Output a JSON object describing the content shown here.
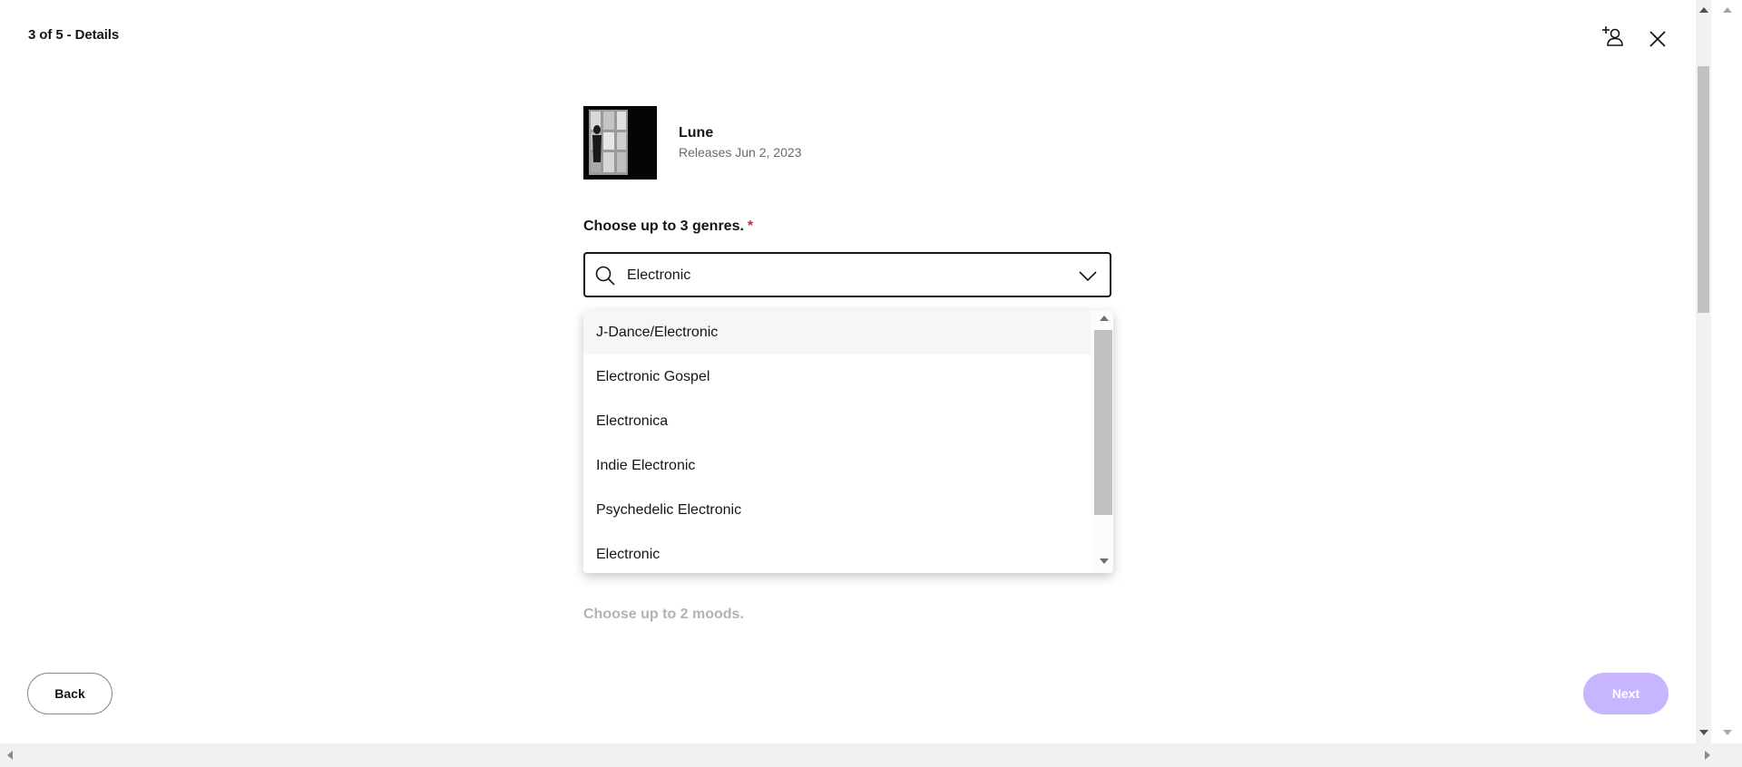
{
  "header": {
    "step_title": "3 of 5 - Details",
    "add_user_icon": "add-user-icon",
    "close_icon": "close-icon"
  },
  "release": {
    "title": "Lune",
    "date": "Releases Jun 2, 2023",
    "cover_icon": "album-cover"
  },
  "genres": {
    "label": "Choose up to 3 genres.",
    "required_mark": "*",
    "search_value": "Electronic",
    "options": [
      "J-Dance/Electronic",
      "Electronic Gospel",
      "Electronica",
      "Indie Electronic",
      "Psychedelic Electronic",
      "Electronic"
    ],
    "highlighted_index": 0
  },
  "moods": {
    "label": "Choose up to 2 moods."
  },
  "footer": {
    "back_label": "Back",
    "next_label": "Next",
    "next_color": "#c7b6ff"
  },
  "colors": {
    "required": "#e22134",
    "text": "#191414",
    "muted": "#6a6a6a"
  }
}
